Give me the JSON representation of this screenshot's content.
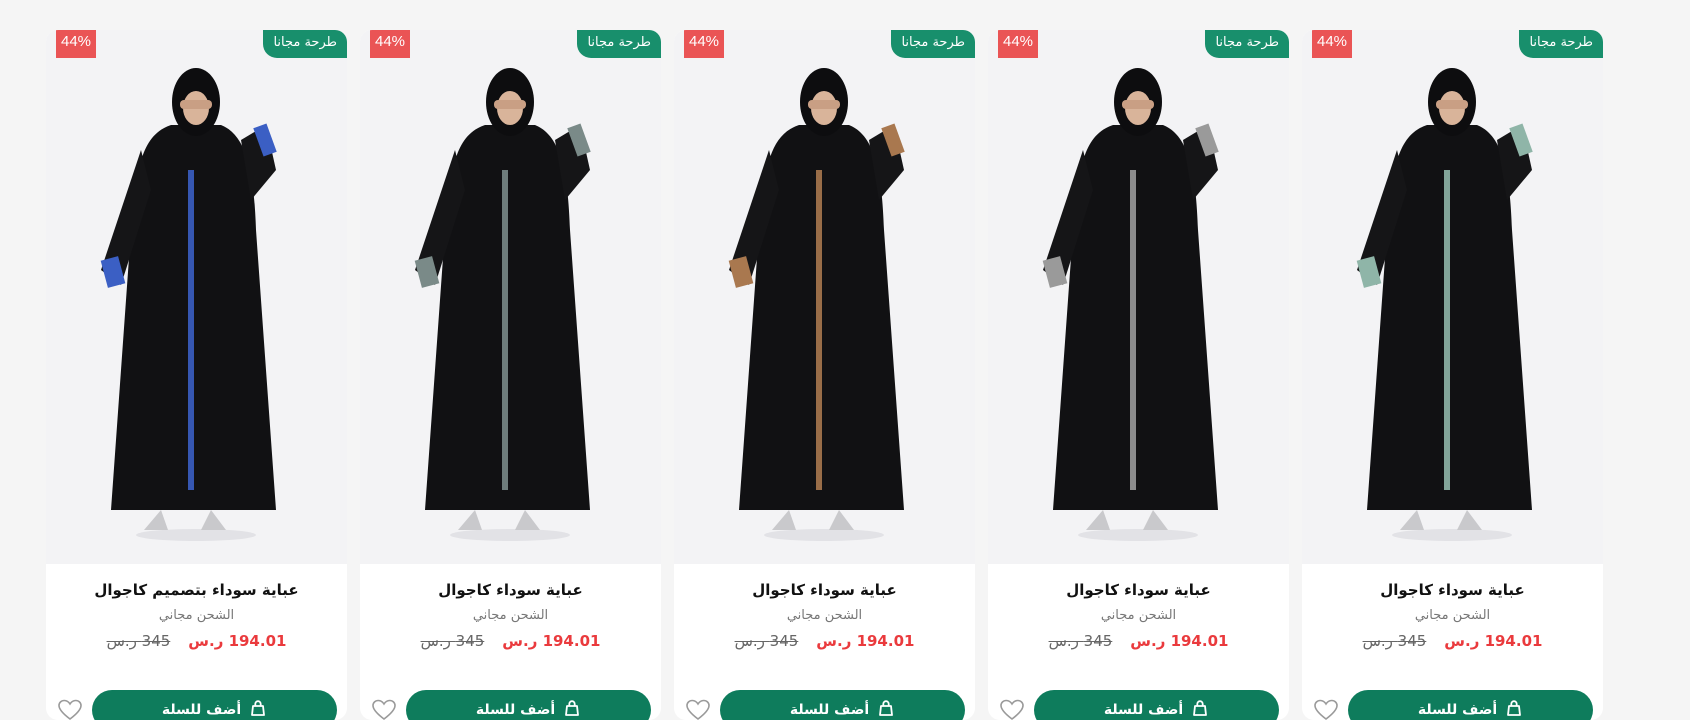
{
  "accent_color": "#0e7c5c",
  "badge_free_color": "#188f6c",
  "discount_color": "#ea5455",
  "products": [
    {
      "discount": "44%",
      "badge_free": "طرحة مجانا",
      "title": "عباية سوداء بتصميم كاجوال",
      "shipping": "الشحن مجاني",
      "price_new": "194.01 ر.س",
      "price_old": "345 ر.س",
      "add_label": "أضف للسلة",
      "icons": [
        "heart-icon",
        "bag-icon"
      ],
      "trim_color": "#3b5fc4"
    },
    {
      "discount": "44%",
      "badge_free": "طرحة مجانا",
      "title": "عباية سوداء كاجوال",
      "shipping": "الشحن مجاني",
      "price_new": "194.01 ر.س",
      "price_old": "345 ر.س",
      "add_label": "أضف للسلة",
      "icons": [
        "heart-icon",
        "bag-icon"
      ],
      "trim_color": "#7a8a88"
    },
    {
      "discount": "44%",
      "badge_free": "طرحة مجانا",
      "title": "عباية سوداء كاجوال",
      "shipping": "الشحن مجاني",
      "price_new": "194.01 ر.س",
      "price_old": "345 ر.س",
      "add_label": "أضف للسلة",
      "icons": [
        "heart-icon",
        "bag-icon"
      ],
      "trim_color": "#a9784f"
    },
    {
      "discount": "44%",
      "badge_free": "طرحة مجانا",
      "title": "عباية سوداء كاجوال",
      "shipping": "الشحن مجاني",
      "price_new": "194.01 ر.س",
      "price_old": "345 ر.س",
      "add_label": "أضف للسلة",
      "icons": [
        "heart-icon",
        "bag-icon"
      ],
      "trim_color": "#9a9a9a"
    },
    {
      "discount": "44%",
      "badge_free": "طرحة مجانا",
      "title": "عباية سوداء كاجوال",
      "shipping": "الشحن مجاني",
      "price_new": "194.01 ر.س",
      "price_old": "345 ر.س",
      "add_label": "أضف للسلة",
      "icons": [
        "heart-icon",
        "bag-icon"
      ],
      "trim_color": "#8fb5a8"
    }
  ]
}
